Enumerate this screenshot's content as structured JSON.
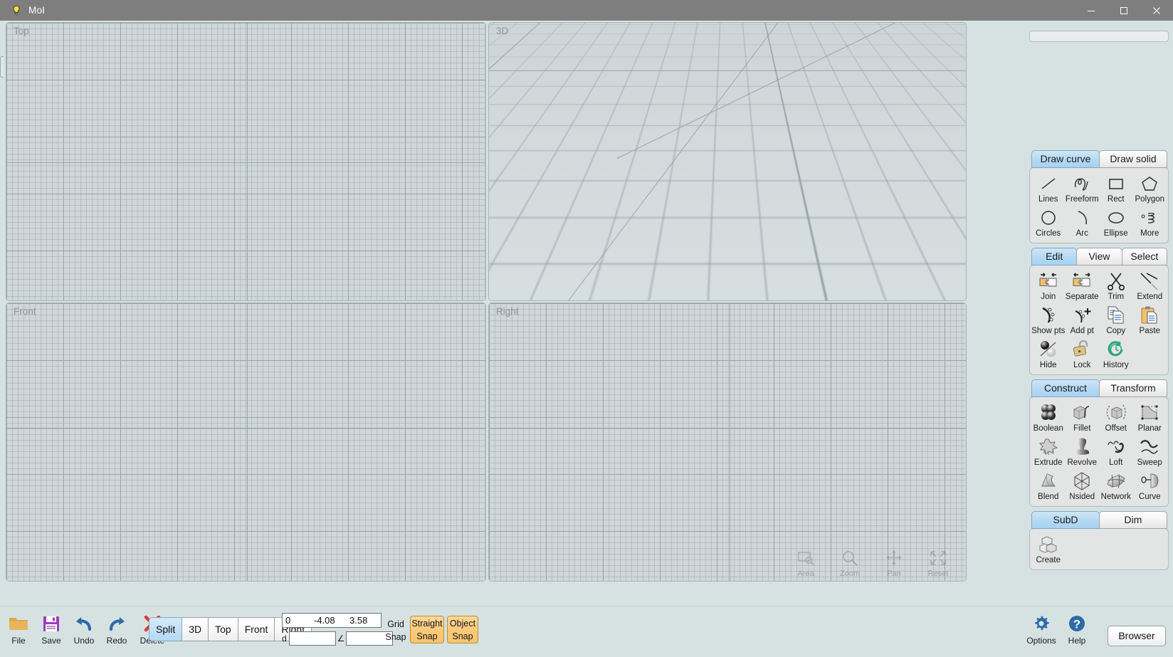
{
  "window": {
    "title": "MoI",
    "icon": "bulb-icon",
    "controls": [
      {
        "name": "minimize",
        "glyph": "─"
      },
      {
        "name": "maximize",
        "glyph": "☐"
      },
      {
        "name": "close",
        "glyph": "✕"
      }
    ]
  },
  "viewports": [
    {
      "name": "top",
      "label": "Top"
    },
    {
      "name": "3d",
      "label": "3D"
    },
    {
      "name": "front",
      "label": "Front"
    },
    {
      "name": "right",
      "label": "Right"
    }
  ],
  "viewport_nav": [
    {
      "name": "area",
      "label": "Area"
    },
    {
      "name": "zoom",
      "label": "Zoom"
    },
    {
      "name": "pan",
      "label": "Pan"
    },
    {
      "name": "reset",
      "label": "Reset"
    }
  ],
  "sidepanel": {
    "draw": {
      "tabs": [
        {
          "label": "Draw curve",
          "active": true
        },
        {
          "label": "Draw solid",
          "active": false
        }
      ],
      "tools": [
        {
          "label": "Lines",
          "icon": "line-icon"
        },
        {
          "label": "Freeform",
          "icon": "freeform-curve-icon"
        },
        {
          "label": "Rect",
          "icon": "rectangle-icon"
        },
        {
          "label": "Polygon",
          "icon": "polygon-icon"
        },
        {
          "label": "Circles",
          "icon": "circle-icon"
        },
        {
          "label": "Arc",
          "icon": "arc-icon"
        },
        {
          "label": "Ellipse",
          "icon": "ellipse-icon"
        },
        {
          "label": "More",
          "icon": "helix-icon"
        }
      ]
    },
    "edit": {
      "tabs": [
        {
          "label": "Edit",
          "active": true
        },
        {
          "label": "View",
          "active": false
        },
        {
          "label": "Select",
          "active": false
        }
      ],
      "tools": [
        {
          "label": "Join",
          "icon": "join-puzzle-icon"
        },
        {
          "label": "Separate",
          "icon": "separate-puzzle-icon"
        },
        {
          "label": "Trim",
          "icon": "scissors-icon"
        },
        {
          "label": "Extend",
          "icon": "extend-line-icon"
        },
        {
          "label": "Show pts",
          "icon": "show-points-icon"
        },
        {
          "label": "Add pt",
          "icon": "add-point-icon"
        },
        {
          "label": "Copy",
          "icon": "copy-documents-icon"
        },
        {
          "label": "Paste",
          "icon": "paste-clipboard-icon"
        },
        {
          "label": "Hide",
          "icon": "hide-spheres-icon"
        },
        {
          "label": "Lock",
          "icon": "padlock-icon"
        },
        {
          "label": "History",
          "icon": "history-clock-icon"
        }
      ]
    },
    "construct": {
      "tabs": [
        {
          "label": "Construct",
          "active": true
        },
        {
          "label": "Transform",
          "active": false
        }
      ],
      "tools": [
        {
          "label": "Boolean",
          "icon": "boolean-spheres-icon"
        },
        {
          "label": "Fillet",
          "icon": "fillet-icon"
        },
        {
          "label": "Offset",
          "icon": "offset-cube-icon"
        },
        {
          "label": "Planar",
          "icon": "planar-icon"
        },
        {
          "label": "Extrude",
          "icon": "extrude-star-icon"
        },
        {
          "label": "Revolve",
          "icon": "revolve-icon"
        },
        {
          "label": "Loft",
          "icon": "loft-icon"
        },
        {
          "label": "Sweep",
          "icon": "sweep-icon"
        },
        {
          "label": "Blend",
          "icon": "blend-icon"
        },
        {
          "label": "Nsided",
          "icon": "nsided-icon"
        },
        {
          "label": "Network",
          "icon": "network-icon"
        },
        {
          "label": "Curve",
          "icon": "curve-icon"
        }
      ]
    },
    "subd": {
      "tabs": [
        {
          "label": "SubD",
          "active": true
        },
        {
          "label": "Dim",
          "active": false
        }
      ],
      "tools": [
        {
          "label": "Create",
          "icon": "subd-create-icon"
        }
      ]
    }
  },
  "bottombar": {
    "actions": [
      {
        "label": "File",
        "icon": "folder-icon"
      },
      {
        "label": "Save",
        "icon": "floppy-disk-icon"
      },
      {
        "label": "Undo",
        "icon": "undo-arrow-icon"
      },
      {
        "label": "Redo",
        "icon": "redo-arrow-icon"
      },
      {
        "label": "Delete",
        "icon": "delete-x-icon"
      }
    ],
    "view_buttons": [
      {
        "label": "Split",
        "active": true
      },
      {
        "label": "3D",
        "active": false
      },
      {
        "label": "Top",
        "active": false
      },
      {
        "label": "Front",
        "active": false
      },
      {
        "label": "Right",
        "active": false
      }
    ],
    "coords": {
      "x": "0",
      "y": "-4.08",
      "z": "3.58"
    },
    "distance": {
      "label": "d",
      "value": ""
    },
    "angle": {
      "label": "∠",
      "value": ""
    },
    "snaps": [
      {
        "name": "grid-snap",
        "line1": "Grid",
        "line2": "Snap",
        "active": false
      },
      {
        "name": "straight-snap",
        "line1": "Straight",
        "line2": "Snap",
        "active": true
      },
      {
        "name": "object-snap",
        "line1": "Object",
        "line2": "Snap",
        "active": true
      }
    ],
    "options": {
      "label": "Options",
      "icon": "gear-icon"
    },
    "help": {
      "label": "Help",
      "icon": "help-question-icon"
    },
    "browser": {
      "label": "Browser"
    }
  },
  "colors": {
    "titlebar": "#7e7e7e",
    "chrome": "#d6e2e2",
    "viewport": "#cfd7d9",
    "accent_tab": "#b4d9f3",
    "snap_active": "#f9c978"
  }
}
